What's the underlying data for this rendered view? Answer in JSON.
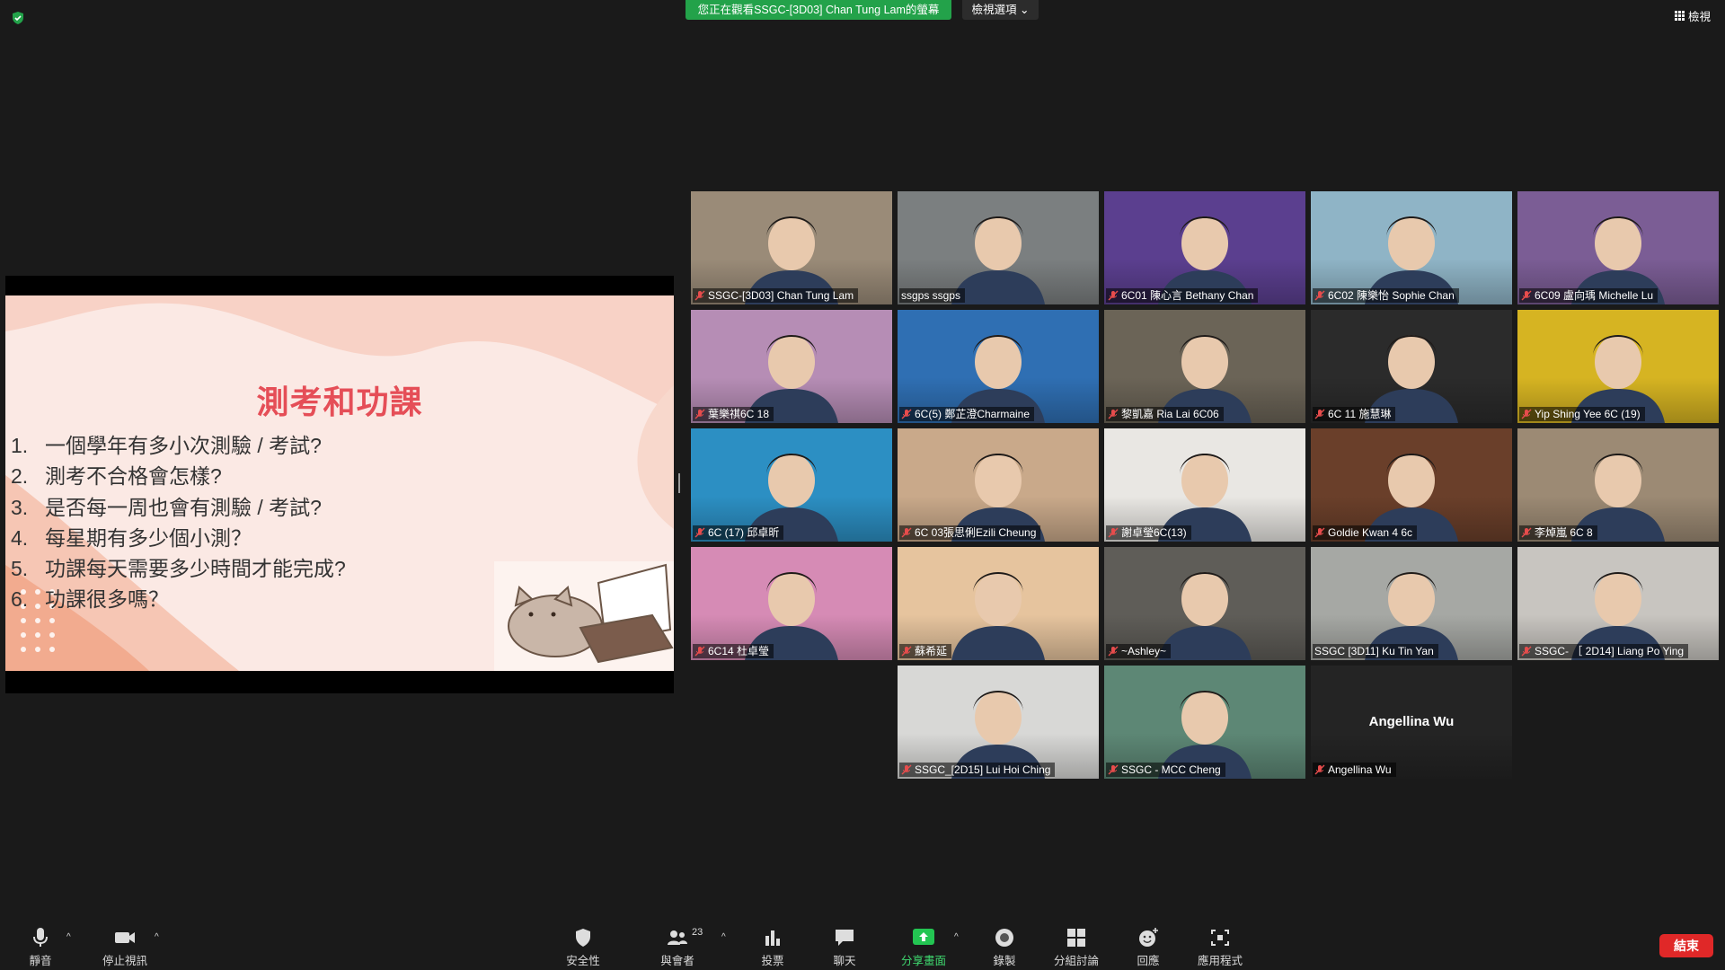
{
  "top_bar": {
    "viewing_banner": "您正在觀看SSGC-[3D03] Chan Tung Lam的螢幕",
    "view_options": "檢視選項",
    "view_button": "檢視"
  },
  "slide": {
    "title": "測考和功課",
    "items": [
      {
        "num": "1.",
        "text": "一個學年有多小次測驗 / 考試?"
      },
      {
        "num": "2.",
        "text": "測考不合格會怎樣?"
      },
      {
        "num": "3.",
        "text": "是否每一周也會有測驗 / 考試?"
      },
      {
        "num": "4.",
        "text": "每星期有多少個小測？"
      },
      {
        "num": "5.",
        "text": "功課每天需要多少時間才能完成?"
      },
      {
        "num": "6.",
        "text": "功課很多嗎？"
      }
    ]
  },
  "participants": [
    {
      "name": "SSGC-[3D03] Chan Tung Lam",
      "bg": "#9a8b78",
      "muted": true
    },
    {
      "name": "ssgps ssgps",
      "bg": "#7b7f80",
      "muted": false
    },
    {
      "name": "6C01 陳心言 Bethany Chan",
      "bg": "#5b3f8f",
      "muted": true
    },
    {
      "name": "6C02 陳樂怡 Sophie Chan",
      "bg": "#8fb4c6",
      "muted": true
    },
    {
      "name": "6C09 盧向瑀 Michelle Lu",
      "bg": "#7b5d95",
      "muted": true
    },
    {
      "name": "葉樂祺6C 18",
      "bg": "#b68db5",
      "muted": true
    },
    {
      "name": "6C(5) 鄭芷澄Charmaine",
      "bg": "#2f6fb3",
      "muted": true
    },
    {
      "name": "黎凱嘉  Ria Lai 6C06",
      "bg": "#6b6457",
      "muted": true
    },
    {
      "name": "6C 11 施慧琳",
      "bg": "#2b2b2b",
      "muted": true
    },
    {
      "name": "Yip Shing Yee 6C (19)",
      "bg": "#d6b422",
      "muted": true
    },
    {
      "name": "6C (17) 邱卓昕",
      "bg": "#2c8fc3",
      "muted": true
    },
    {
      "name": "6C 03張思俐Ezili Cheung",
      "bg": "#c9a98a",
      "muted": true
    },
    {
      "name": "謝卓瑩6C(13)",
      "bg": "#e9e7e3",
      "muted": true
    },
    {
      "name": "Goldie Kwan 4 6c",
      "bg": "#6a3f2a",
      "muted": true
    },
    {
      "name": "李焯嵐 6C 8",
      "bg": "#9c8a74",
      "muted": true
    },
    {
      "name": "6C14 杜卓瑩",
      "bg": "#d68bb5",
      "muted": true
    },
    {
      "name": "蘇希延",
      "bg": "#e6c49e",
      "muted": true
    },
    {
      "name": "~Ashley~",
      "bg": "#5f5d58",
      "muted": true
    },
    {
      "name": "SSGC [3D11] Ku Tin Yan",
      "bg": "#a6a8a4",
      "muted": false
    },
    {
      "name": "SSGC- ［ 2D14] Liang Po Ying",
      "bg": "#c8c5c0",
      "muted": true
    },
    {
      "name": "SSGC_[2D15] Lui Hoi Ching",
      "bg": "#d8d8d6",
      "muted": true
    },
    {
      "name": "SSGC - MCC Cheng",
      "bg": "#5d8775",
      "muted": true
    },
    {
      "name": "Angellina Wu",
      "bg": "#242424",
      "muted": true,
      "display_name": "Angellina Wu"
    }
  ],
  "toolbar": {
    "mute": "靜音",
    "stop_video": "停止視訊",
    "security": "安全性",
    "participants": "與會者",
    "participant_count": "23",
    "polls": "投票",
    "chat": "聊天",
    "share_screen": "分享畫面",
    "record": "錄製",
    "breakout": "分組討論",
    "reactions": "回應",
    "apps": "應用程式",
    "end": "結束"
  }
}
